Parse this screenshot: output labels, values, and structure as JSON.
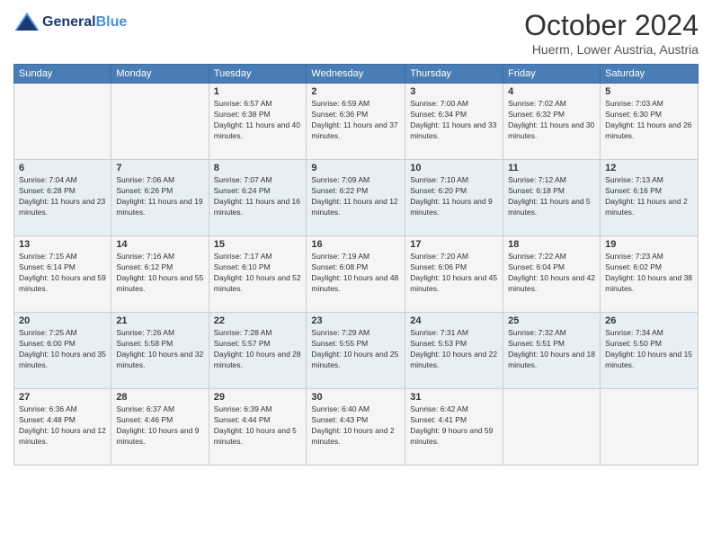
{
  "header": {
    "logo_line1": "General",
    "logo_line2": "Blue",
    "month": "October 2024",
    "location": "Huerm, Lower Austria, Austria"
  },
  "days_of_week": [
    "Sunday",
    "Monday",
    "Tuesday",
    "Wednesday",
    "Thursday",
    "Friday",
    "Saturday"
  ],
  "weeks": [
    [
      {
        "num": "",
        "sunrise": "",
        "sunset": "",
        "daylight": ""
      },
      {
        "num": "",
        "sunrise": "",
        "sunset": "",
        "daylight": ""
      },
      {
        "num": "1",
        "sunrise": "Sunrise: 6:57 AM",
        "sunset": "Sunset: 6:38 PM",
        "daylight": "Daylight: 11 hours and 40 minutes."
      },
      {
        "num": "2",
        "sunrise": "Sunrise: 6:59 AM",
        "sunset": "Sunset: 6:36 PM",
        "daylight": "Daylight: 11 hours and 37 minutes."
      },
      {
        "num": "3",
        "sunrise": "Sunrise: 7:00 AM",
        "sunset": "Sunset: 6:34 PM",
        "daylight": "Daylight: 11 hours and 33 minutes."
      },
      {
        "num": "4",
        "sunrise": "Sunrise: 7:02 AM",
        "sunset": "Sunset: 6:32 PM",
        "daylight": "Daylight: 11 hours and 30 minutes."
      },
      {
        "num": "5",
        "sunrise": "Sunrise: 7:03 AM",
        "sunset": "Sunset: 6:30 PM",
        "daylight": "Daylight: 11 hours and 26 minutes."
      }
    ],
    [
      {
        "num": "6",
        "sunrise": "Sunrise: 7:04 AM",
        "sunset": "Sunset: 6:28 PM",
        "daylight": "Daylight: 11 hours and 23 minutes."
      },
      {
        "num": "7",
        "sunrise": "Sunrise: 7:06 AM",
        "sunset": "Sunset: 6:26 PM",
        "daylight": "Daylight: 11 hours and 19 minutes."
      },
      {
        "num": "8",
        "sunrise": "Sunrise: 7:07 AM",
        "sunset": "Sunset: 6:24 PM",
        "daylight": "Daylight: 11 hours and 16 minutes."
      },
      {
        "num": "9",
        "sunrise": "Sunrise: 7:09 AM",
        "sunset": "Sunset: 6:22 PM",
        "daylight": "Daylight: 11 hours and 12 minutes."
      },
      {
        "num": "10",
        "sunrise": "Sunrise: 7:10 AM",
        "sunset": "Sunset: 6:20 PM",
        "daylight": "Daylight: 11 hours and 9 minutes."
      },
      {
        "num": "11",
        "sunrise": "Sunrise: 7:12 AM",
        "sunset": "Sunset: 6:18 PM",
        "daylight": "Daylight: 11 hours and 5 minutes."
      },
      {
        "num": "12",
        "sunrise": "Sunrise: 7:13 AM",
        "sunset": "Sunset: 6:16 PM",
        "daylight": "Daylight: 11 hours and 2 minutes."
      }
    ],
    [
      {
        "num": "13",
        "sunrise": "Sunrise: 7:15 AM",
        "sunset": "Sunset: 6:14 PM",
        "daylight": "Daylight: 10 hours and 59 minutes."
      },
      {
        "num": "14",
        "sunrise": "Sunrise: 7:16 AM",
        "sunset": "Sunset: 6:12 PM",
        "daylight": "Daylight: 10 hours and 55 minutes."
      },
      {
        "num": "15",
        "sunrise": "Sunrise: 7:17 AM",
        "sunset": "Sunset: 6:10 PM",
        "daylight": "Daylight: 10 hours and 52 minutes."
      },
      {
        "num": "16",
        "sunrise": "Sunrise: 7:19 AM",
        "sunset": "Sunset: 6:08 PM",
        "daylight": "Daylight: 10 hours and 48 minutes."
      },
      {
        "num": "17",
        "sunrise": "Sunrise: 7:20 AM",
        "sunset": "Sunset: 6:06 PM",
        "daylight": "Daylight: 10 hours and 45 minutes."
      },
      {
        "num": "18",
        "sunrise": "Sunrise: 7:22 AM",
        "sunset": "Sunset: 6:04 PM",
        "daylight": "Daylight: 10 hours and 42 minutes."
      },
      {
        "num": "19",
        "sunrise": "Sunrise: 7:23 AM",
        "sunset": "Sunset: 6:02 PM",
        "daylight": "Daylight: 10 hours and 38 minutes."
      }
    ],
    [
      {
        "num": "20",
        "sunrise": "Sunrise: 7:25 AM",
        "sunset": "Sunset: 6:00 PM",
        "daylight": "Daylight: 10 hours and 35 minutes."
      },
      {
        "num": "21",
        "sunrise": "Sunrise: 7:26 AM",
        "sunset": "Sunset: 5:58 PM",
        "daylight": "Daylight: 10 hours and 32 minutes."
      },
      {
        "num": "22",
        "sunrise": "Sunrise: 7:28 AM",
        "sunset": "Sunset: 5:57 PM",
        "daylight": "Daylight: 10 hours and 28 minutes."
      },
      {
        "num": "23",
        "sunrise": "Sunrise: 7:29 AM",
        "sunset": "Sunset: 5:55 PM",
        "daylight": "Daylight: 10 hours and 25 minutes."
      },
      {
        "num": "24",
        "sunrise": "Sunrise: 7:31 AM",
        "sunset": "Sunset: 5:53 PM",
        "daylight": "Daylight: 10 hours and 22 minutes."
      },
      {
        "num": "25",
        "sunrise": "Sunrise: 7:32 AM",
        "sunset": "Sunset: 5:51 PM",
        "daylight": "Daylight: 10 hours and 18 minutes."
      },
      {
        "num": "26",
        "sunrise": "Sunrise: 7:34 AM",
        "sunset": "Sunset: 5:50 PM",
        "daylight": "Daylight: 10 hours and 15 minutes."
      }
    ],
    [
      {
        "num": "27",
        "sunrise": "Sunrise: 6:36 AM",
        "sunset": "Sunset: 4:48 PM",
        "daylight": "Daylight: 10 hours and 12 minutes."
      },
      {
        "num": "28",
        "sunrise": "Sunrise: 6:37 AM",
        "sunset": "Sunset: 4:46 PM",
        "daylight": "Daylight: 10 hours and 9 minutes."
      },
      {
        "num": "29",
        "sunrise": "Sunrise: 6:39 AM",
        "sunset": "Sunset: 4:44 PM",
        "daylight": "Daylight: 10 hours and 5 minutes."
      },
      {
        "num": "30",
        "sunrise": "Sunrise: 6:40 AM",
        "sunset": "Sunset: 4:43 PM",
        "daylight": "Daylight: 10 hours and 2 minutes."
      },
      {
        "num": "31",
        "sunrise": "Sunrise: 6:42 AM",
        "sunset": "Sunset: 4:41 PM",
        "daylight": "Daylight: 9 hours and 59 minutes."
      },
      {
        "num": "",
        "sunrise": "",
        "sunset": "",
        "daylight": ""
      },
      {
        "num": "",
        "sunrise": "",
        "sunset": "",
        "daylight": ""
      }
    ]
  ]
}
